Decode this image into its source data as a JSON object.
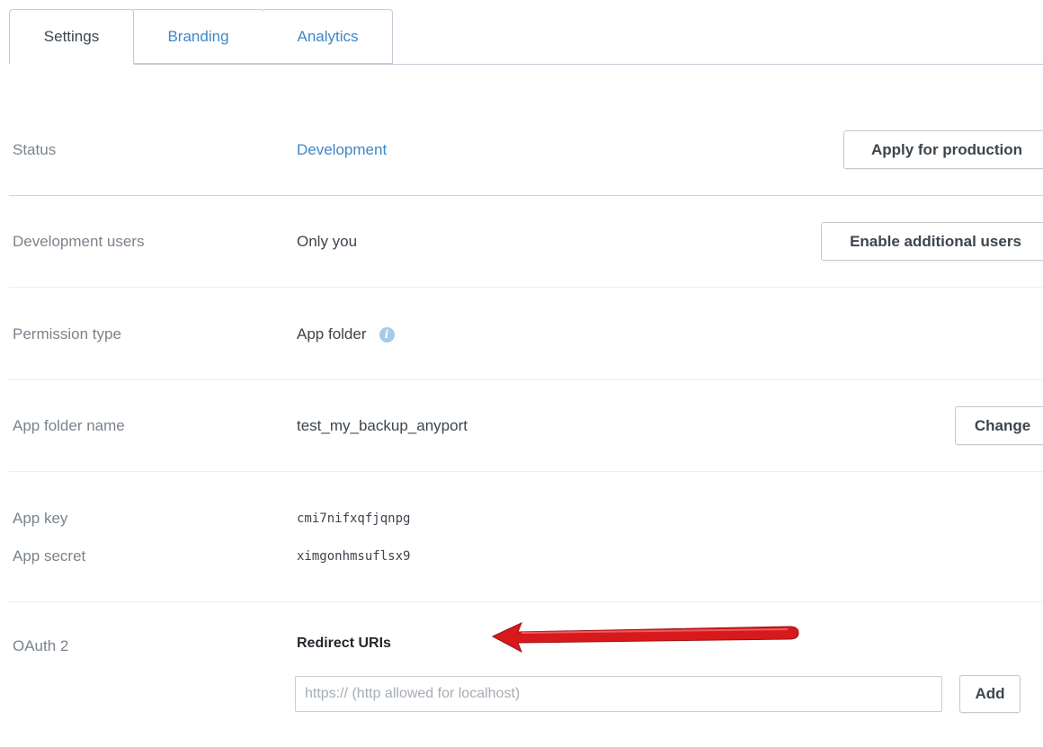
{
  "tabs": [
    {
      "label": "Settings",
      "active": true
    },
    {
      "label": "Branding",
      "active": false
    },
    {
      "label": "Analytics",
      "active": false
    }
  ],
  "status": {
    "label": "Status",
    "value": "Development",
    "button": "Apply for production"
  },
  "dev_users": {
    "label": "Development users",
    "value": "Only you",
    "button": "Enable additional users"
  },
  "permission": {
    "label": "Permission type",
    "value": "App folder",
    "icon": "info-icon"
  },
  "folder": {
    "label": "App folder name",
    "value": "test_my_backup_anyport",
    "button": "Change"
  },
  "app_key": {
    "label": "App key",
    "value": "cmi7nifxqfjqnpg"
  },
  "app_secret": {
    "label": "App secret",
    "value": "ximgonhmsuflsx9"
  },
  "oauth": {
    "label": "OAuth 2",
    "redirect_title": "Redirect URIs",
    "input_placeholder": "https:// (http allowed for localhost)",
    "input_value": "",
    "add_button": "Add"
  },
  "colors": {
    "link": "#3d87c9",
    "annotation_arrow": "#d8191c"
  }
}
